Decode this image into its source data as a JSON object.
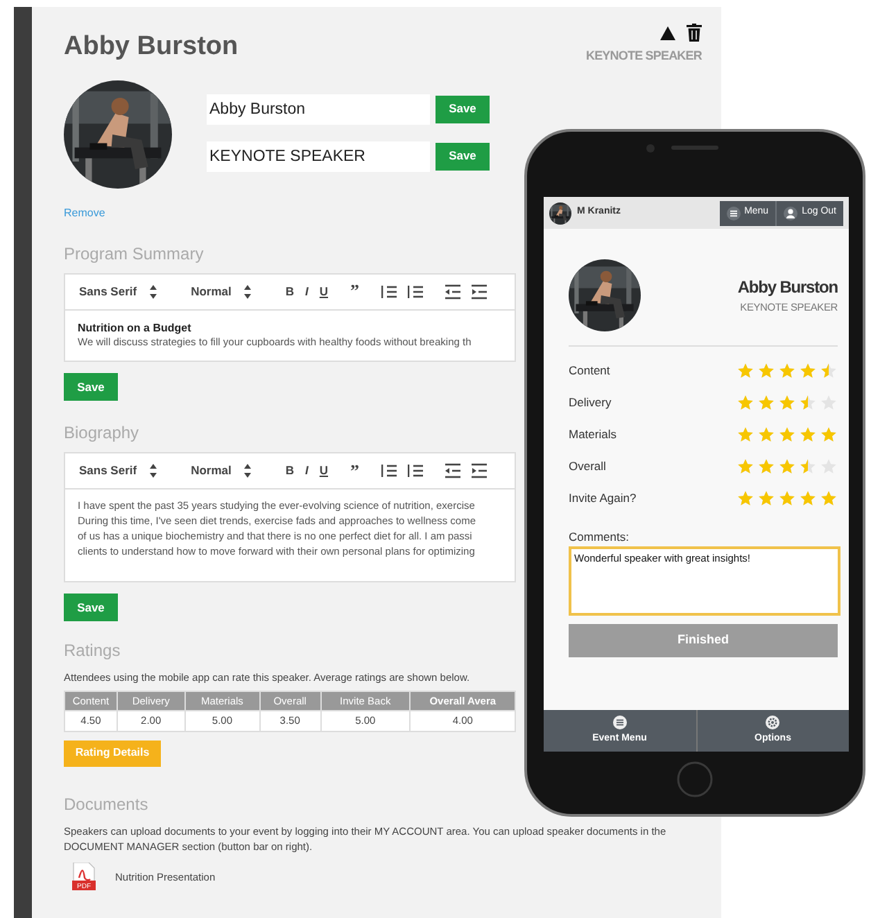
{
  "admin": {
    "title": "Abby Burston",
    "role_label": "KEYNOTE SPEAKER",
    "fields": [
      {
        "value": "Abby Burston",
        "button": "Save"
      },
      {
        "value": "KEYNOTE SPEAKER",
        "button": "Save"
      }
    ],
    "remove_link": "Remove",
    "program_summary": {
      "heading": "Program Summary",
      "toolbar": {
        "font": "Sans Serif",
        "size": "Normal",
        "bold": "B",
        "italic": "I",
        "underline": "U",
        "quote": "”"
      },
      "content_title": "Nutrition on a Budget",
      "lines": [
        "We will discuss strategies to fill your cupboards with healthy foods without breaking th"
      ],
      "button": "Save"
    },
    "biography": {
      "heading": "Biography",
      "toolbar": {
        "font": "Sans Serif",
        "size": "Normal",
        "bold": "B",
        "italic": "I",
        "underline": "U",
        "quote": "”"
      },
      "lines": [
        "I have spent the past 35 years studying the ever-evolving science of nutrition, exercise",
        "During this time, I've seen diet trends, exercise fads and approaches to wellness come",
        "of us has a unique biochemistry and that there is no one perfect diet for all. I am passi",
        "clients to understand how to move forward with their own personal plans for optimizing"
      ],
      "button": "Save"
    },
    "ratings": {
      "heading": "Ratings",
      "note": "Attendees using the mobile app can rate this speaker. Average ratings are shown below.",
      "table": {
        "columns": [
          "Content",
          "Delivery",
          "Materials",
          "Overall",
          "Invite Back",
          "Overall Avera"
        ],
        "rows": [
          [
            "4.50",
            "2.00",
            "5.00",
            "3.50",
            "5.00",
            "4.00"
          ]
        ]
      },
      "button": "Rating Details"
    },
    "documents": {
      "heading": "Documents",
      "note": "Speakers can upload documents to your event by logging into their MY ACCOUNT area. You can upload speaker documents in the DOCUMENT MANAGER section (button bar on right).",
      "files": [
        {
          "name": "Nutrition Presentation",
          "type_label": "PDF"
        }
      ]
    }
  },
  "phone": {
    "user": "M Kranitz",
    "header_buttons": [
      {
        "label": "Menu",
        "kind": "menu"
      },
      {
        "label": "Log Out",
        "kind": "user"
      }
    ],
    "speaker": {
      "name": "Abby Burston",
      "role": "KEYNOTE SPEAKER"
    },
    "ratings": [
      {
        "label": "Content",
        "stars": 4.5
      },
      {
        "label": "Delivery",
        "stars": 3.5
      },
      {
        "label": "Materials",
        "stars": 5
      },
      {
        "label": "Overall",
        "stars": 3.5
      },
      {
        "label": "Invite Again?",
        "stars": 5
      }
    ],
    "comments_label": "Comments:",
    "comment": "Wonderful speaker with great insights!",
    "finish_button": "Finished",
    "tabs": [
      {
        "label": "Event Menu",
        "kind": "list"
      },
      {
        "label": "Options",
        "kind": "gear"
      }
    ]
  }
}
